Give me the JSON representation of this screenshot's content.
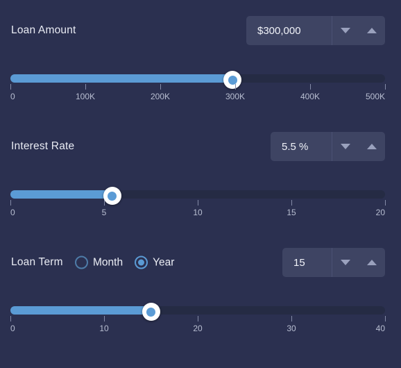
{
  "theme": {
    "background": "#2b3050",
    "accent": "#5b9bd5",
    "input_bg": "#3e4463",
    "track_bg": "#252b44",
    "text": "#e9ebf3"
  },
  "rows": [
    {
      "id": "loan-amount",
      "label": "Loan Amount",
      "input": {
        "value": "$300,000",
        "decrement_icon": "triangle-down-icon",
        "increment_icon": "triangle-up-icon"
      },
      "slider": {
        "value": 300000,
        "min": 0,
        "max": 500000,
        "fill_percent": 59.3,
        "ticks": [
          {
            "label": "0",
            "percent": 0
          },
          {
            "label": "100K",
            "percent": 20
          },
          {
            "label": "200K",
            "percent": 40
          },
          {
            "label": "300K",
            "percent": 60
          },
          {
            "label": "400K",
            "percent": 80
          },
          {
            "label": "500K",
            "percent": 100
          }
        ]
      }
    },
    {
      "id": "interest-rate",
      "label": "Interest Rate",
      "input": {
        "value": "5.5 %",
        "decrement_icon": "triangle-down-icon",
        "increment_icon": "triangle-up-icon"
      },
      "slider": {
        "value": 5.5,
        "min": 0,
        "max": 20,
        "fill_percent": 27.2,
        "ticks": [
          {
            "label": "0",
            "percent": 0
          },
          {
            "label": "5",
            "percent": 25
          },
          {
            "label": "10",
            "percent": 50
          },
          {
            "label": "15",
            "percent": 75
          },
          {
            "label": "20",
            "percent": 100
          }
        ]
      }
    },
    {
      "id": "loan-term",
      "label": "Loan Term",
      "radios": [
        {
          "label": "Month",
          "checked": false
        },
        {
          "label": "Year",
          "checked": true
        }
      ],
      "input": {
        "value": "15",
        "decrement_icon": "triangle-down-icon",
        "increment_icon": "triangle-up-icon"
      },
      "slider": {
        "value": 15,
        "min": 0,
        "max": 40,
        "fill_percent": 37.5,
        "ticks": [
          {
            "label": "0",
            "percent": 0
          },
          {
            "label": "10",
            "percent": 25
          },
          {
            "label": "20",
            "percent": 50
          },
          {
            "label": "30",
            "percent": 75
          },
          {
            "label": "40",
            "percent": 100
          }
        ]
      }
    }
  ]
}
